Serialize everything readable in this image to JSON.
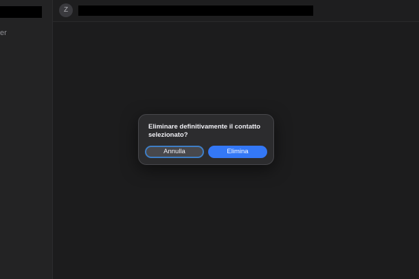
{
  "sidebar": {
    "item_fragment": "er"
  },
  "header": {
    "avatar_initial": "Z"
  },
  "dialog": {
    "message": "Eliminare definitivamente il contatto selezionato?",
    "cancel_label": "Annulla",
    "confirm_label": "Elimina"
  },
  "colors": {
    "background": "#1c1c1d",
    "dialog": "#2c2c2e",
    "accent": "#3478f6",
    "focus_ring": "#3f7fc7"
  }
}
